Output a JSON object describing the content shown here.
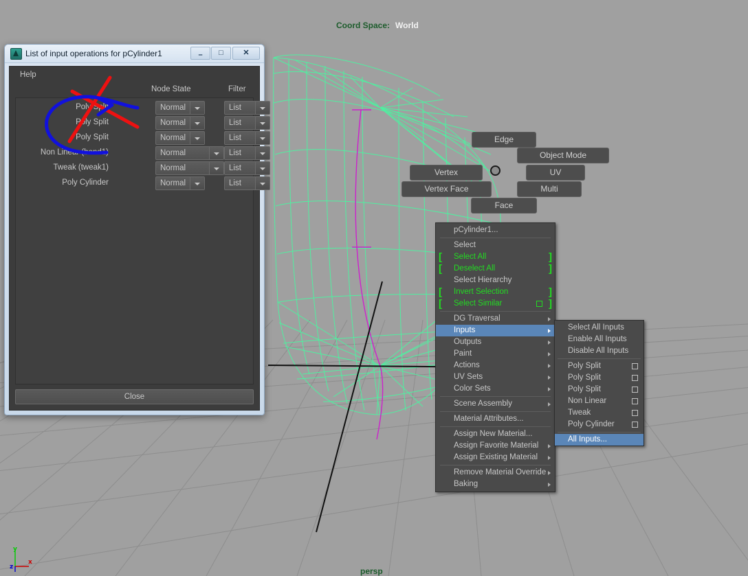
{
  "viewport": {
    "coord_space_label": "Coord Space:",
    "coord_space_value": "World",
    "camera_label": "persp",
    "axis_labels": {
      "x": "x",
      "y": "y",
      "z": "z"
    },
    "component_labels": [
      {
        "name": "edge",
        "text": "Edge"
      },
      {
        "name": "object-mode",
        "text": "Object Mode"
      },
      {
        "name": "vertex",
        "text": "Vertex"
      },
      {
        "name": "uv",
        "text": "UV"
      },
      {
        "name": "vertex-face",
        "text": "Vertex Face"
      },
      {
        "name": "multi",
        "text": "Multi"
      },
      {
        "name": "face",
        "text": "Face"
      }
    ],
    "colors": {
      "background": "#a0a0a0",
      "grid": "#8a8a8a",
      "wireframe": "#4ff0a0",
      "deformer": "#cc22cc",
      "axis_line": "#101010",
      "label_bg": "#4d4d4d",
      "label_text": "#d2d2d2",
      "coord_space_text": "#1d5c2c"
    }
  },
  "context_menu": {
    "items": [
      {
        "label": "pCylinder1...",
        "style": "normal",
        "submenu": false,
        "sep_after": true
      },
      {
        "label": "Select",
        "style": "normal",
        "submenu": false
      },
      {
        "label": "Select All",
        "style": "green",
        "submenu": false,
        "brackets": true
      },
      {
        "label": "Deselect All",
        "style": "green",
        "submenu": false,
        "brackets": true
      },
      {
        "label": "Select Hierarchy",
        "style": "normal",
        "submenu": false
      },
      {
        "label": "Invert Selection",
        "style": "green",
        "submenu": false,
        "brackets": true
      },
      {
        "label": "Select Similar",
        "style": "green",
        "submenu": false,
        "brackets": true,
        "optionbox": true,
        "sep_after": true
      },
      {
        "label": "DG Traversal",
        "style": "normal",
        "submenu": true
      },
      {
        "label": "Inputs",
        "style": "selected",
        "submenu": true
      },
      {
        "label": "Outputs",
        "style": "normal",
        "submenu": true
      },
      {
        "label": "Paint",
        "style": "normal",
        "submenu": true
      },
      {
        "label": "Actions",
        "style": "normal",
        "submenu": true
      },
      {
        "label": "UV Sets",
        "style": "normal",
        "submenu": true
      },
      {
        "label": "Color Sets",
        "style": "normal",
        "submenu": true,
        "sep_after": true
      },
      {
        "label": "Scene Assembly",
        "style": "normal",
        "submenu": true,
        "sep_after": true
      },
      {
        "label": "Material Attributes...",
        "style": "normal",
        "submenu": false,
        "sep_after": true
      },
      {
        "label": "Assign New Material...",
        "style": "normal",
        "submenu": false
      },
      {
        "label": "Assign Favorite Material",
        "style": "normal",
        "submenu": true
      },
      {
        "label": "Assign Existing Material",
        "style": "normal",
        "submenu": true,
        "sep_after": true
      },
      {
        "label": "Remove Material Override",
        "style": "normal",
        "submenu": true
      },
      {
        "label": "Baking",
        "style": "normal",
        "submenu": true
      }
    ],
    "highlight_color": "#5a86b8",
    "green_color": "#22dd22"
  },
  "sub_menu": {
    "items": [
      {
        "label": "Select All Inputs",
        "checkbox": false,
        "selected": false
      },
      {
        "label": "Enable All Inputs",
        "checkbox": false,
        "selected": false
      },
      {
        "label": "Disable All Inputs",
        "checkbox": false,
        "selected": false,
        "sep_after": true
      },
      {
        "label": "Poly Split",
        "checkbox": true,
        "selected": false
      },
      {
        "label": "Poly Split",
        "checkbox": true,
        "selected": false
      },
      {
        "label": "Poly Split",
        "checkbox": true,
        "selected": false
      },
      {
        "label": "Non Linear",
        "checkbox": true,
        "selected": false
      },
      {
        "label": "Tweak",
        "checkbox": true,
        "selected": false
      },
      {
        "label": "Poly Cylinder",
        "checkbox": true,
        "selected": false,
        "sep_after": true
      },
      {
        "label": "All Inputs...",
        "checkbox": false,
        "selected": true
      }
    ]
  },
  "dialog": {
    "title": "List of input operations for pCylinder1",
    "window_buttons": {
      "minimize": "–",
      "maximize": "□",
      "close": "✕"
    },
    "menu": {
      "help": "Help"
    },
    "columns": {
      "node_state": "Node State",
      "filter": "Filter"
    },
    "rows": [
      {
        "label": "Poly Split",
        "node_state": "Normal",
        "filter": "List",
        "wide": false
      },
      {
        "label": "Poly Split",
        "node_state": "Normal",
        "filter": "List",
        "wide": false
      },
      {
        "label": "Poly Split",
        "node_state": "Normal",
        "filter": "List",
        "wide": false
      },
      {
        "label": "Non Linear (bend1)",
        "node_state": "Normal",
        "filter": "List",
        "wide": true
      },
      {
        "label": "Tweak (tweak1)",
        "node_state": "Normal",
        "filter": "List",
        "wide": true
      },
      {
        "label": "Poly Cylinder",
        "node_state": "Normal",
        "filter": "List",
        "wide": false
      }
    ],
    "close_button": "Close"
  },
  "annotations": {
    "red_x_color": "#ee1111",
    "blue_arrow_color": "#1111dd"
  }
}
